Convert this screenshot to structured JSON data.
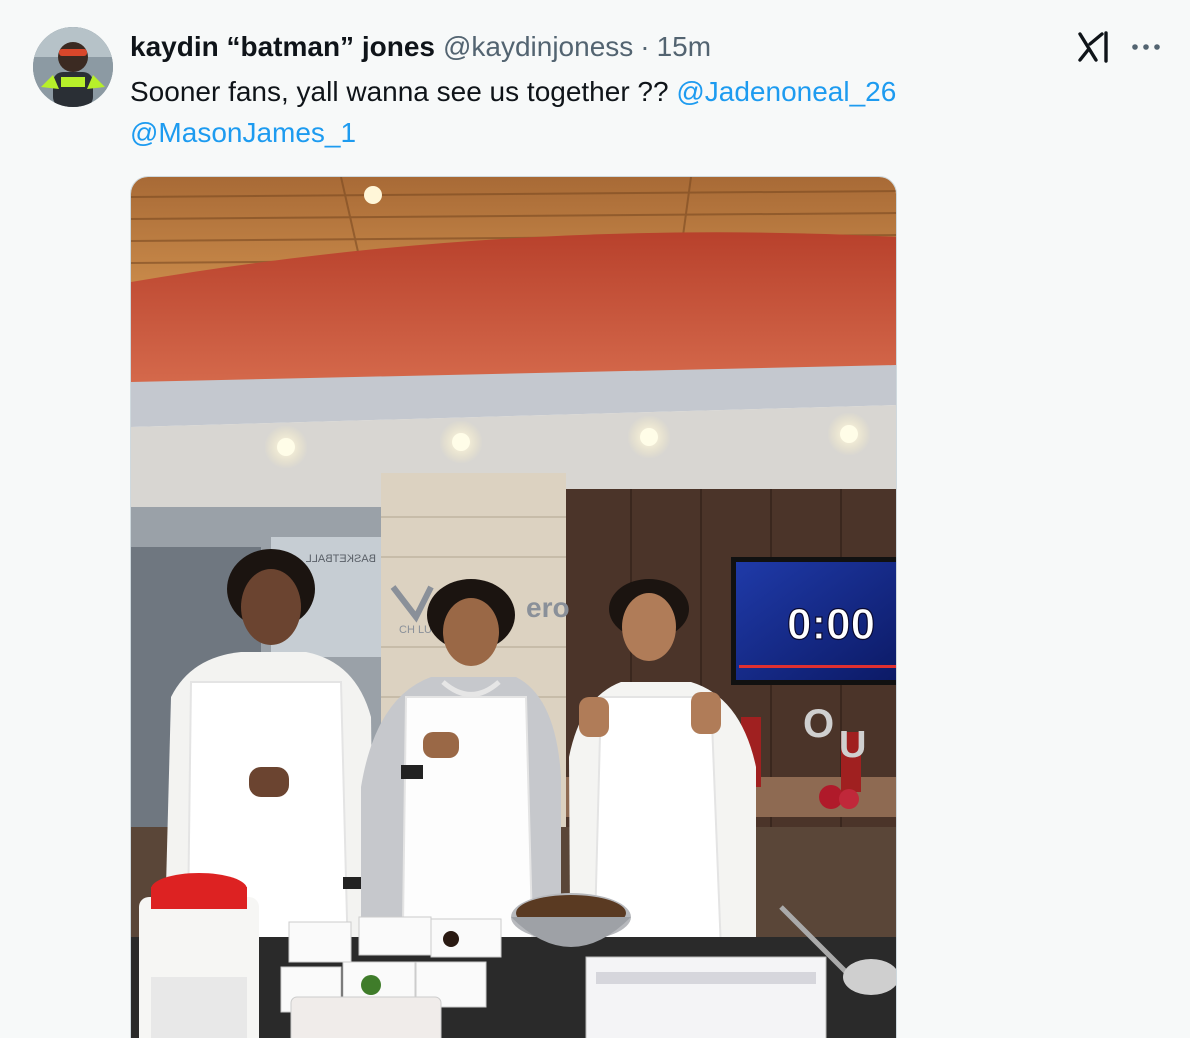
{
  "author": {
    "display_name": "kaydin “batman” jones",
    "handle": "@kaydinjoness",
    "separator": "·",
    "time": "15m"
  },
  "tweet": {
    "text": "Sooner fans, yall wanna see us together ?? ",
    "mentions": [
      "@Jadenoneal_26",
      "@MasonJames_1"
    ]
  },
  "media": {
    "wall_text_valero": "ero",
    "wall_text_club": "CH          LUB",
    "scoreboard_time": "0:00",
    "mirrored_sign": "BASKETBALL"
  },
  "icons": {
    "grok": "grok-icon",
    "more": "more-icon"
  },
  "colors": {
    "link": "#1d9bf0",
    "text_primary": "#0f1419",
    "text_secondary": "#536471",
    "background": "#f7f9f9"
  }
}
